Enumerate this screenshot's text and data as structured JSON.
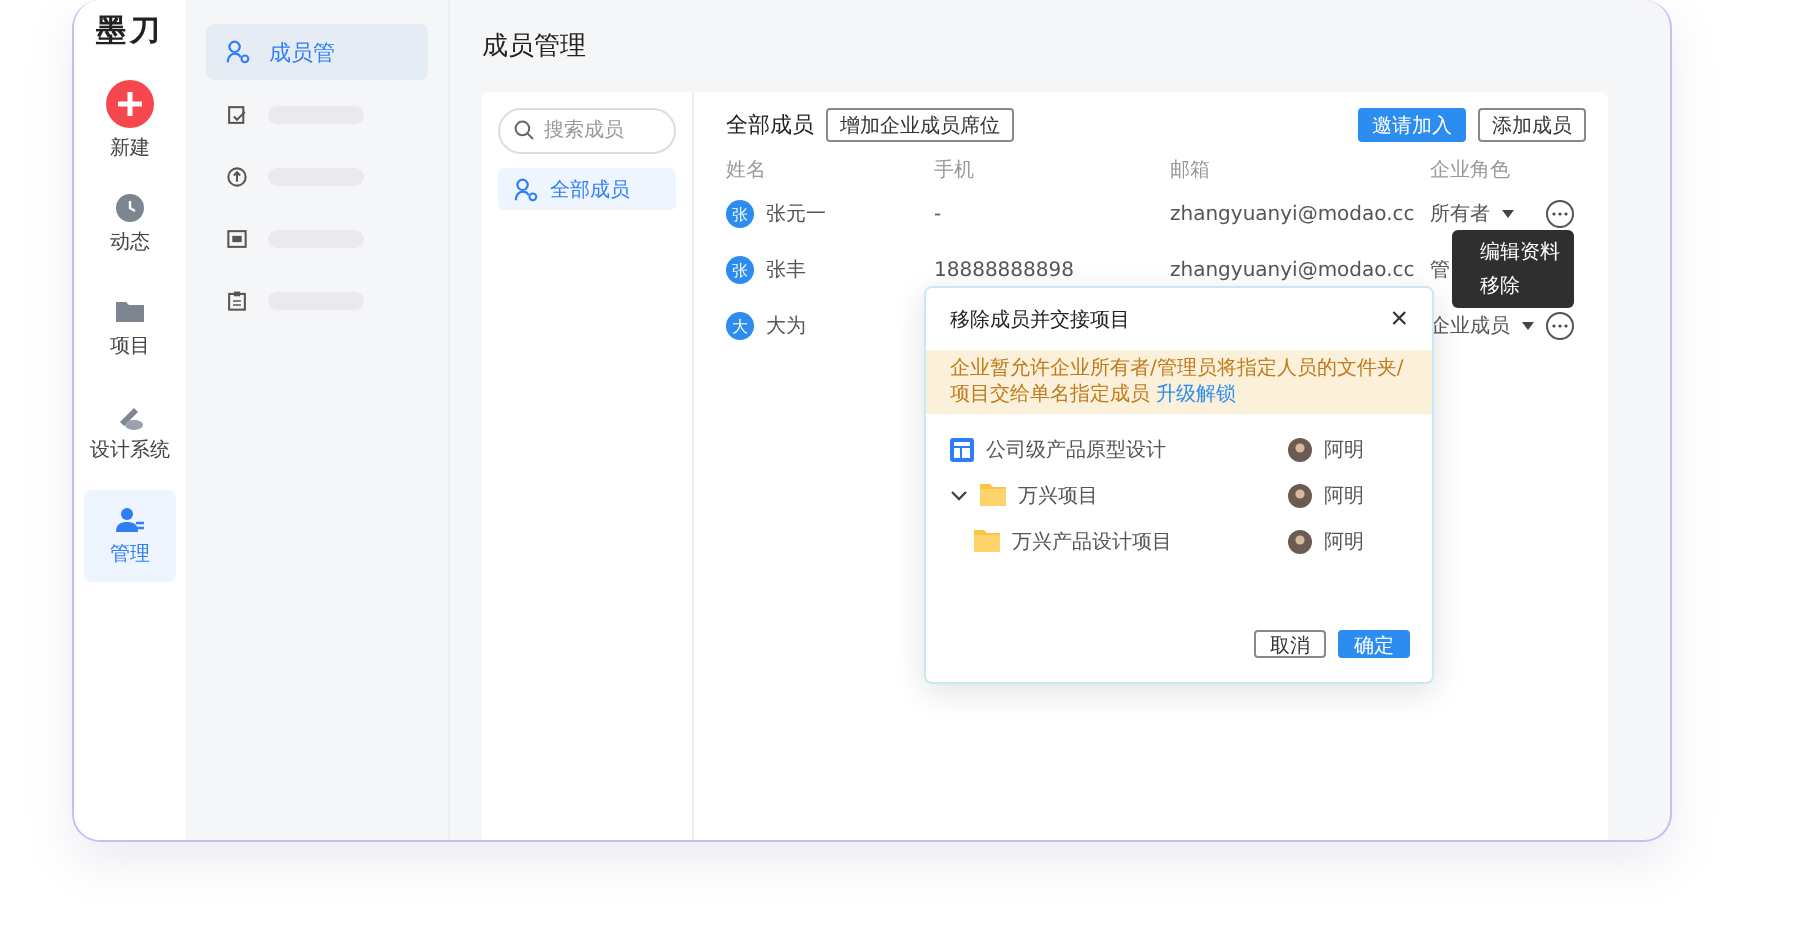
{
  "app": {
    "logo": "墨刀"
  },
  "rail": [
    {
      "label": "新建",
      "kind": "create",
      "selected": false
    },
    {
      "label": "动态",
      "kind": "nav",
      "selected": false
    },
    {
      "label": "项目",
      "kind": "nav",
      "selected": false
    },
    {
      "label": "设计系统",
      "kind": "nav",
      "selected": false
    },
    {
      "label": "管理",
      "kind": "nav",
      "selected": true
    }
  ],
  "subnav": [
    {
      "kind": "label",
      "label": "成员管",
      "selected": true
    },
    {
      "kind": "skeleton",
      "selected": false
    },
    {
      "kind": "skeleton",
      "selected": false
    },
    {
      "kind": "skeleton",
      "selected": false
    },
    {
      "kind": "skeleton",
      "selected": false
    }
  ],
  "page_title": "成员管理",
  "members_panel": {
    "search": {
      "placeholder": "搜索成员"
    },
    "groups": [
      {
        "label": "全部成员",
        "selected": true
      }
    ]
  },
  "content": {
    "heading": "全部成员",
    "seat_button": "增加企业成员席位",
    "actions": [
      {
        "label": "邀请加入",
        "kind": "primary"
      },
      {
        "label": "添加成员",
        "kind": "secondary"
      }
    ],
    "columns": [
      "姓名",
      "手机",
      "邮箱",
      "企业角色"
    ],
    "rows": [
      {
        "avatar": "张",
        "name": "张元一",
        "phone": "-",
        "email": "zhangyuanyi@modao.cc",
        "role": "所有者",
        "caret": true,
        "more": true
      },
      {
        "avatar": "张",
        "name": "张丰",
        "phone": "18888888898",
        "email": "zhangyuanyi@modao.cc",
        "role": "管",
        "caret": false,
        "more": false
      },
      {
        "avatar": "大",
        "name": "大为",
        "role": "企业成员",
        "caret": true,
        "more": true
      }
    ],
    "context_menu": [
      "编辑资料",
      "移除"
    ]
  },
  "dialog": {
    "title": "移除成员并交接项目",
    "close": "×",
    "notice": {
      "text": "企业暂允许企业所有者/管理员将指定人员的文件夹/项目交给单名指定成员",
      "link": "升级解锁"
    },
    "items": [
      {
        "kind": "file",
        "name": "公司级产品原型设计",
        "owner": "阿明"
      },
      {
        "kind": "folder",
        "name": "万兴项目",
        "owner": "阿明",
        "expanded": true,
        "children": [
          {
            "kind": "folder",
            "name": "万兴产品设计项目",
            "owner": "阿明"
          }
        ]
      }
    ],
    "buttons": [
      {
        "label": "取消",
        "kind": "secondary"
      },
      {
        "label": "确定",
        "kind": "primary"
      }
    ]
  }
}
